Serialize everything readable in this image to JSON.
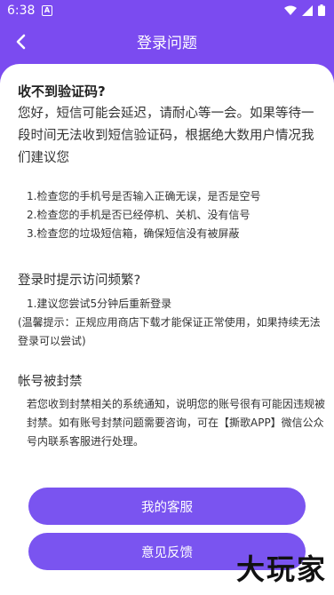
{
  "status_bar": {
    "time": "6:38",
    "notification_glyph": "A"
  },
  "header": {
    "title": "登录问题",
    "back_icon": "chevron-left-icon"
  },
  "sections": {
    "code": {
      "title": "收不到验证码?",
      "body": "您好，短信可能会延迟，请耐心等一会。如果等待一段时间无法收到短信验证码，根据绝大数用户情况我们建议您",
      "steps": [
        "1.检查您的手机号是否输入正确无误，是否是空号",
        "2.检查您的手机是否已经停机、关机、没有信号",
        "3.检查您的垃圾短信箱，确保短信没有被屏蔽"
      ]
    },
    "frequency": {
      "title": "登录时提示访问频繁?",
      "step": "1.建议您尝试5分钟后重新登录",
      "tip": "(温馨提示：正规应用商店下载才能保证正常使用，如果持续无法登录可以尝试)"
    },
    "banned": {
      "title": "帐号被封禁",
      "body": "若您收到封禁相关的系统通知，说明您的账号很有可能因违规被封禁。如有账号封禁问题需要咨询，可在【撕歌APP】微信公众号内联系客服进行处理。"
    }
  },
  "buttons": {
    "service": "我的客服",
    "feedback": "意见反馈"
  },
  "watermark": "大玩家",
  "colors": {
    "accent": "#7b4bf0",
    "button": "#7a54f0"
  }
}
